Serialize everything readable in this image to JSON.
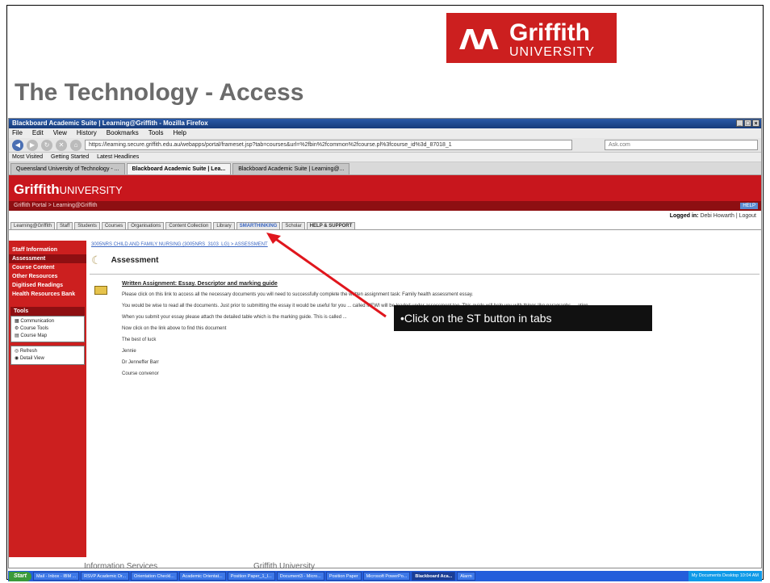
{
  "slide": {
    "title": "The Technology - Access",
    "logo": {
      "mark": "ᐱᐱ",
      "name": "Griffith",
      "uni": "UNIVERSITY"
    },
    "footer_left": "Information Services",
    "footer_mid": "Griffith University",
    "callout": "•Click on the ST button in tabs"
  },
  "browser": {
    "title": "Blackboard Academic Suite | Learning@Griffith - Mozilla Firefox",
    "menu": [
      "File",
      "Edit",
      "View",
      "History",
      "Bookmarks",
      "Tools",
      "Help"
    ],
    "url": "https://learning.secure.griffith.edu.au/webapps/portal/frameset.jsp?tab=courses&url=%2fbin%2fcommon%2fcourse.pl%3fcourse_id%3d_87018_1",
    "search_placeholder": "Ask.com",
    "bookmarks": [
      "Most Visited",
      "Getting Started",
      "Latest Headlines"
    ],
    "tabs": [
      {
        "label": "Queensland University of Technology - ..."
      },
      {
        "label": "Blackboard Academic Suite | Lea..."
      },
      {
        "label": "Blackboard Academic Suite | Learning@..."
      }
    ]
  },
  "bb": {
    "logo_bold": "Griffith",
    "logo_light": "UNIVERSITY",
    "breadcrumb_top": "Griffith Portal > Learning@Griffith",
    "help": "HELP",
    "logged_in_label": "Logged in:",
    "logged_in_user": "Debi Howarth | Logout",
    "tabs": [
      "Learning@Griffith",
      "Staff",
      "Students",
      "Courses",
      "Organisations",
      "Content Collection",
      "Library",
      "SMARTHINKING",
      "Scholar",
      "HELP & SUPPORT"
    ],
    "crumbs": "3005NRS CHILD AND FAMILY NURSING (3005NRS_3103_LG) > ASSESSMENT",
    "page_heading": "Assessment",
    "sidebar": {
      "items": [
        "Staff Information",
        "Assessment",
        "Course Content",
        "Other Resources",
        "Digitised Readings",
        "Health Resources Bank"
      ],
      "tools_title": "Tools",
      "tools": [
        "Communication",
        "Course Tools",
        "Course Map"
      ],
      "actions": [
        "Refresh",
        "Detail View"
      ]
    },
    "item": {
      "link": "Written Assignment: Essay. Descriptor and marking guide",
      "p1": "Please click on this link to access all the necessary documents you will need to successfully complete the written assignment task: Family health assessment essay.",
      "p2": "You would be wise to read all the documents. Just prior to submitting the essay it would be useful for you ... called MEWI will be loaded under assessment too. This guide will help you with things like paragraphs ... ation",
      "p3": "When you submit your essay please attach the detailed table which is the marking guide. This is called ...",
      "p4": "Now click on the link above to find this document",
      "p5": "The best of luck",
      "p6": "Jennie",
      "p7": "Dr Jenneffer Barr",
      "p8": "Course convenor"
    }
  },
  "taskbar": {
    "start": "Start",
    "items": [
      "Mail - Inbox - IBM ...",
      "RSVP Academic Dr...",
      "Orientation Checkl...",
      "Academic Orientat...",
      "Position Paper_1_I...",
      "Document3 - Micro...",
      "Position Paper",
      "Microsoft PowerPo...",
      "Blackboard Aca...",
      "Alarm"
    ],
    "tray": "My Documents  Desktop  10:04 AM"
  }
}
